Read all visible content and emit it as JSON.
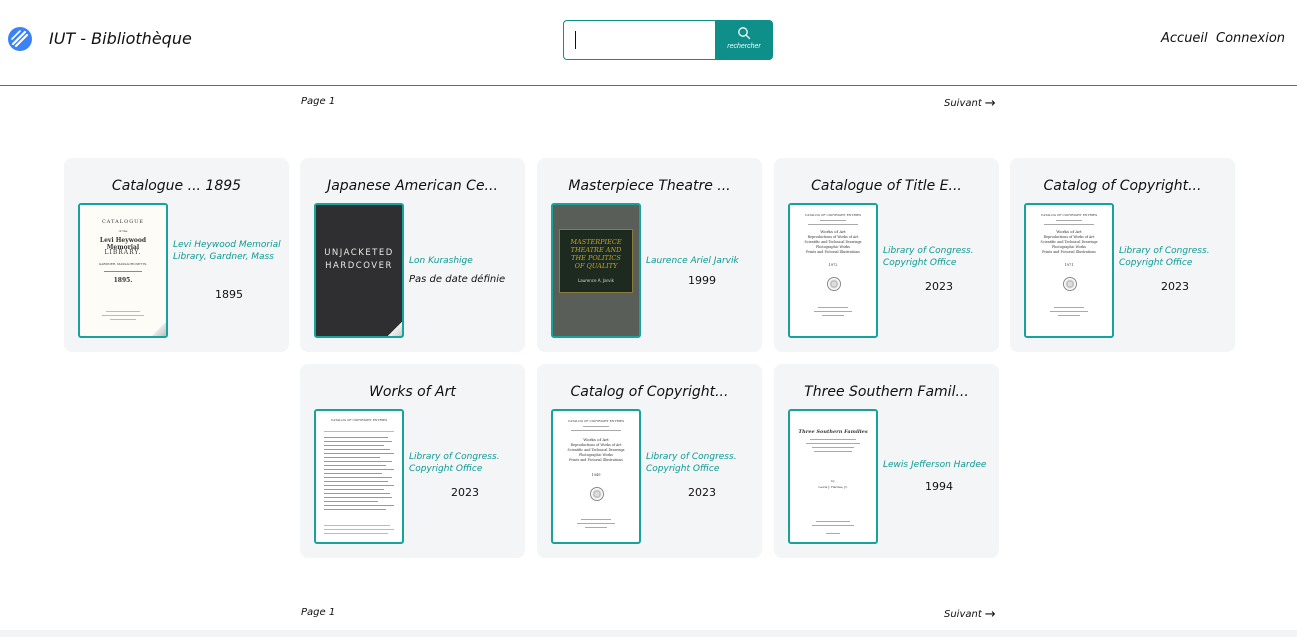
{
  "header": {
    "brand": "IUT - Bibliothèque",
    "search_button_label": "rechercher",
    "search_value": "",
    "nav": {
      "home": "Accueil",
      "login": "Connexion"
    }
  },
  "pagination_top": {
    "page": "Page 1",
    "next": "Suivant"
  },
  "pagination_bottom": {
    "page": "Page 1",
    "next": "Suivant"
  },
  "cards": [
    {
      "title": "Catalogue ... 1895",
      "author": "Levi Heywood Memorial Library, Gardner, Mass",
      "date": "1895",
      "cover": {
        "lines": [
          "CATALOGUE",
          "of the",
          "Levi Heywood Memorial",
          "LIBRARY.",
          "GARDNER, MASSACHUSETTS.",
          "1895."
        ]
      }
    },
    {
      "title": "Japanese American Ce...",
      "author": "Lon Kurashige",
      "date": "Pas de date définie",
      "cover": {
        "lines": [
          "UNJACKETED",
          "HARDCOVER"
        ]
      }
    },
    {
      "title": "Masterpiece Theatre ...",
      "author": "Laurence Ariel Jarvik",
      "date": "1999",
      "cover": {
        "lines": [
          "MASTERPIECE",
          "THEATRE AND",
          "THE POLITICS",
          "OF QUALITY",
          "Laurence A. Jarvik"
        ]
      }
    },
    {
      "title": "Catalogue of Title E...",
      "author": "Library of Congress. Copyright Office",
      "date": "2023",
      "cover": {
        "lines": [
          "CATALOG OF COPYRIGHT ENTRIES",
          "Works of Art",
          "Reproductions of Works of Art",
          "Scientific and Technical Drawings",
          "Photographic Works",
          "Prints and Pictorial Illustrations",
          "1972"
        ]
      }
    },
    {
      "title": "Catalog of Copyright...",
      "author": "Library of Congress. Copyright Office",
      "date": "2023",
      "cover": {
        "lines": [
          "CATALOG OF COPYRIGHT ENTRIES",
          "Works of Art",
          "Reproductions of Works of Art",
          "Scientific and Technical Drawings",
          "Photographic Works",
          "Prints and Pictorial Illustrations",
          "1971"
        ]
      }
    },
    {
      "title": "Works of Art",
      "author": "Library of Congress. Copyright Office",
      "date": "2023",
      "cover": {
        "lines": [
          "CATALOG OF COPYRIGHT ENTRIES"
        ]
      }
    },
    {
      "title": "Catalog of Copyright...",
      "author": "Library of Congress. Copyright Office",
      "date": "2023",
      "cover": {
        "lines": [
          "CATALOG OF COPYRIGHT ENTRIES",
          "Works of Art",
          "Reproductions of Works of Art",
          "Scientific and Technical Drawings",
          "Photographic Works",
          "Prints and Pictorial Illustrations",
          "1949"
        ]
      }
    },
    {
      "title": "Three Southern Famil...",
      "author": "Lewis Jefferson Hardee",
      "date": "1994",
      "cover": {
        "lines": [
          "Three Southern Families",
          "by",
          "Lewis J. Hardee, Jr."
        ]
      }
    }
  ]
}
